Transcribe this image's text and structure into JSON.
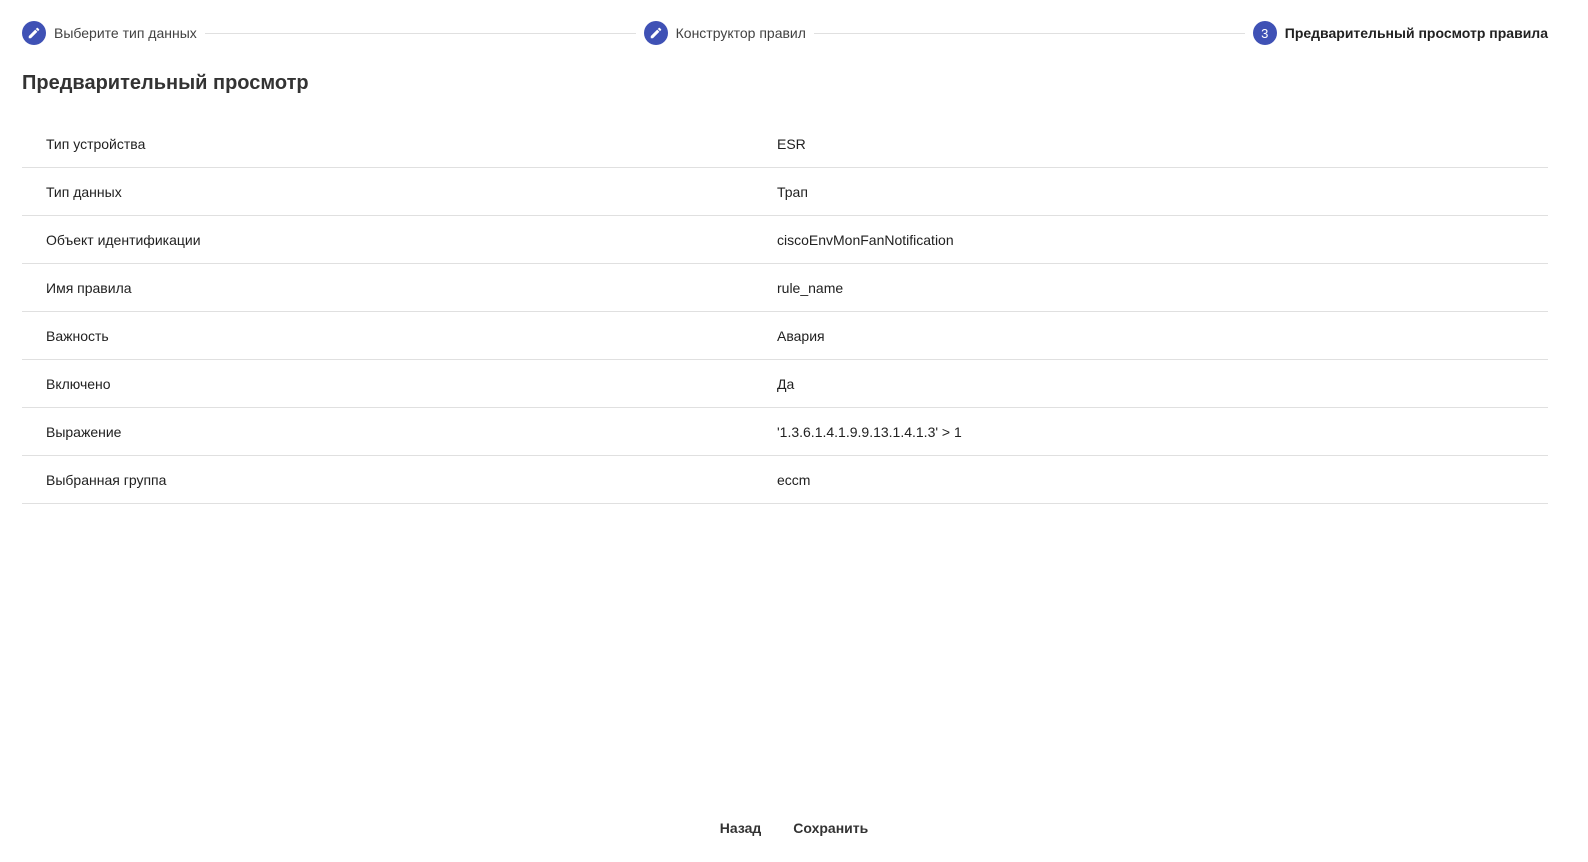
{
  "stepper": {
    "steps": [
      {
        "label": "Выберите тип данных",
        "icon": "edit-icon"
      },
      {
        "label": "Конструктор правил",
        "icon": "edit-icon"
      },
      {
        "label": "Предварительный просмотр правила",
        "number": "3"
      }
    ],
    "accent_color": "#3f51b5"
  },
  "page_title": "Предварительный просмотр",
  "preview": {
    "rows": [
      {
        "label": "Тип устройства",
        "value": "ESR"
      },
      {
        "label": "Тип данных",
        "value": "Трап"
      },
      {
        "label": "Объект идентификации",
        "value": "ciscoEnvMonFanNotification"
      },
      {
        "label": "Имя правила",
        "value": "rule_name"
      },
      {
        "label": "Важность",
        "value": "Авария"
      },
      {
        "label": "Включено",
        "value": "Да"
      },
      {
        "label": "Выражение",
        "value": "'1.3.6.1.4.1.9.9.13.1.4.1.3' > 1"
      },
      {
        "label": "Выбранная группа",
        "value": "eccm"
      }
    ]
  },
  "actions": {
    "back_label": "Назад",
    "save_label": "Сохранить"
  }
}
